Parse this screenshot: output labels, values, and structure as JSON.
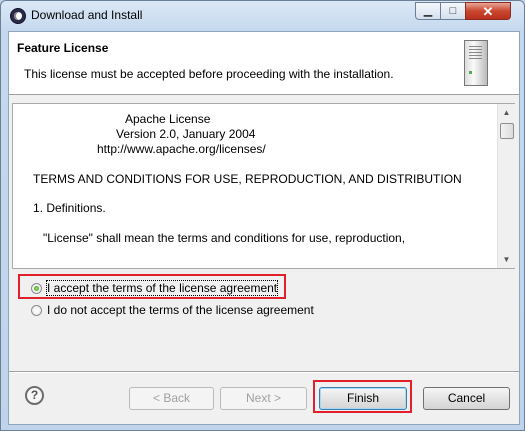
{
  "window": {
    "title": "Download and Install",
    "minimize_glyph": "▁",
    "maximize_glyph": "□",
    "close_glyph": "✕"
  },
  "header": {
    "title": "Feature License",
    "description": "This license must be accepted before proceeding with the installation.",
    "icon": "server-icon"
  },
  "license": {
    "lines": [
      "Apache License",
      "Version 2.0, January 2004",
      "http://www.apache.org/licenses/",
      "TERMS AND CONDITIONS FOR USE, REPRODUCTION, AND DISTRIBUTION",
      "1. Definitions.",
      "\"License\" shall mean the terms and conditions for use, reproduction,"
    ]
  },
  "options": {
    "accept_label": "I accept the terms of the license agreement",
    "decline_label": "I do not accept the terms of the license agreement",
    "selected": "accept"
  },
  "buttons": {
    "help": "?",
    "back": "< Back",
    "next": "Next >",
    "finish": "Finish",
    "cancel": "Cancel"
  },
  "colors": {
    "highlight": "#e0202a"
  }
}
